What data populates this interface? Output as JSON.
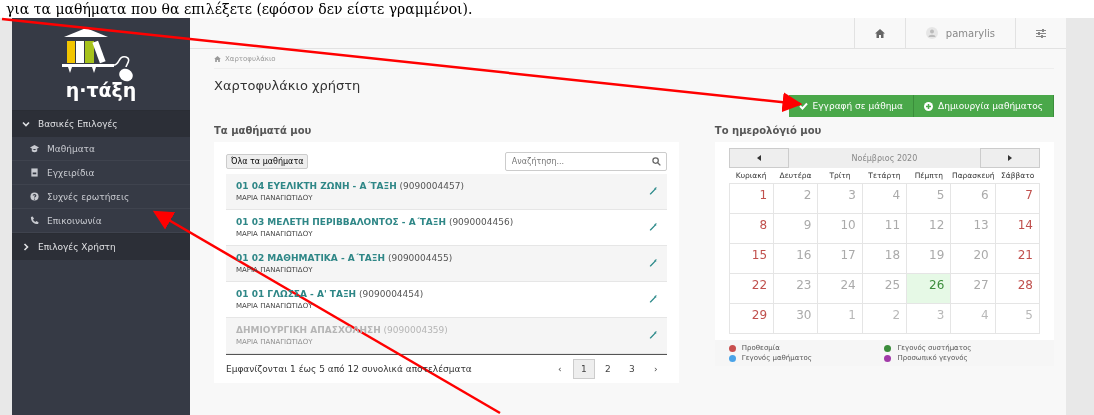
{
  "caption": "για τα μαθήματα που θα επιλέξετε (εφόσον δεν είστε γραμμένοι).",
  "logo": {
    "text": "η·τάξη"
  },
  "sidebar": {
    "sections": [
      {
        "label": "Βασικές Επιλογές",
        "expanded": true,
        "items": [
          {
            "label": "Μαθήματα",
            "kind": "courses"
          },
          {
            "label": "Εγχειρίδια",
            "kind": "manuals"
          },
          {
            "label": "Συχνές ερωτήσεις",
            "kind": "faq"
          },
          {
            "label": "Επικοινωνία",
            "kind": "contact"
          }
        ]
      },
      {
        "label": "Επιλογές Χρήστη",
        "expanded": false
      }
    ]
  },
  "topbar": {
    "username": "pamarylis"
  },
  "breadcrumb": "Χαρτοφυλάκιο",
  "page_title": "Χαρτοφυλάκιο χρήστη",
  "actions": [
    {
      "label": "Εγγραφή σε μάθημα",
      "kind": "enroll"
    },
    {
      "label": "Δημιουργία μαθήματος",
      "kind": "create"
    }
  ],
  "courses": {
    "title": "Τα μαθήματά μου",
    "filter_button": "Όλα τα μαθήματα",
    "search": {
      "placeholder": "Αναζήτηση..."
    },
    "rows": [
      {
        "name": "01 04 ΕΥΕΛΙΚΤΗ ΖΩΝΗ - Α΄ΤΑΞΗ",
        "code": "(9090004457)",
        "teacher": "ΜΑΡΙΑ ΠΑΝΑΓΙΩΤΙΔΟΥ",
        "disabled": false
      },
      {
        "name": "01 03 ΜΕΛΕΤΗ ΠΕΡΙΒΒΑΛΟΝΤΟΣ - Α΄ΤΑΞΗ",
        "code": "(9090004456)",
        "teacher": "ΜΑΡΙΑ ΠΑΝΑΓΙΩΤΙΔΟΥ",
        "disabled": false
      },
      {
        "name": "01 02 ΜΑΘΗΜΑΤΙΚΑ - Α΄ΤΑΞΗ",
        "code": "(9090004455)",
        "teacher": "ΜΑΡΙΑ ΠΑΝΑΓΙΩΤΙΔΟΥ",
        "disabled": false
      },
      {
        "name": "01 01 ΓΛΩΣΣΑ - Α' ΤΑΞΗ",
        "code": "(9090004454)",
        "teacher": "ΜΑΡΙΑ ΠΑΝΑΓΙΩΤΙΔΟΥ",
        "disabled": false
      },
      {
        "name": "ΔΗΜΙΟΥΡΓΙΚΗ ΑΠΑΣΧΟΛΗΣΗ",
        "code": "(9090004359)",
        "teacher": "ΜΑΡΙΑ ΠΑΝΑΓΙΩΤΙΔΟΥ",
        "disabled": true
      }
    ],
    "summary": "Εμφανίζονται 1 έως 5 από 12 συνολικά αποτελέσματα",
    "pages": [
      {
        "label": "‹",
        "selected": false
      },
      {
        "label": "1",
        "selected": true
      },
      {
        "label": "2",
        "selected": false
      },
      {
        "label": "3",
        "selected": false
      },
      {
        "label": "›",
        "selected": false
      }
    ]
  },
  "calendar": {
    "title": "Το ημερολόγιό μου",
    "month": "Νοέμβριος 2020",
    "weekdays": [
      "Κυριακή",
      "Δευτέρα",
      "Τρίτη",
      "Τετάρτη",
      "Πέμπτη",
      "Παρασκευή",
      "Σάββατο"
    ],
    "weeks": [
      [
        {
          "day": "1",
          "weekend": true
        },
        {
          "day": "2"
        },
        {
          "day": "3"
        },
        {
          "day": "4"
        },
        {
          "day": "5"
        },
        {
          "day": "6"
        },
        {
          "day": "7",
          "weekend": true
        }
      ],
      [
        {
          "day": "8",
          "weekend": true
        },
        {
          "day": "9"
        },
        {
          "day": "10"
        },
        {
          "day": "11"
        },
        {
          "day": "12"
        },
        {
          "day": "13"
        },
        {
          "day": "14",
          "weekend": true
        }
      ],
      [
        {
          "day": "15",
          "weekend": true
        },
        {
          "day": "16"
        },
        {
          "day": "17"
        },
        {
          "day": "18"
        },
        {
          "day": "19"
        },
        {
          "day": "20"
        },
        {
          "day": "21",
          "weekend": true
        }
      ],
      [
        {
          "day": "22",
          "weekend": true
        },
        {
          "day": "23"
        },
        {
          "day": "24"
        },
        {
          "day": "25"
        },
        {
          "day": "26",
          "today": true
        },
        {
          "day": "27"
        },
        {
          "day": "28",
          "weekend": true
        }
      ],
      [
        {
          "day": "29",
          "weekend": true
        },
        {
          "day": "30"
        },
        {
          "day": "1",
          "outside": true
        },
        {
          "day": "2",
          "outside": true
        },
        {
          "day": "3",
          "outside": true
        },
        {
          "day": "4",
          "outside": true
        },
        {
          "day": "5",
          "outside": true
        }
      ]
    ],
    "legend": [
      {
        "label": "Προθεσμία",
        "color": "#c9504f"
      },
      {
        "label": "Γεγονός συστήματος",
        "color": "#3c8d3c"
      },
      {
        "label": "Γεγονός μαθήματος",
        "color": "#4aa3e8"
      },
      {
        "label": "Προσωπικό γεγονός",
        "color": "#a13aa8"
      }
    ]
  }
}
